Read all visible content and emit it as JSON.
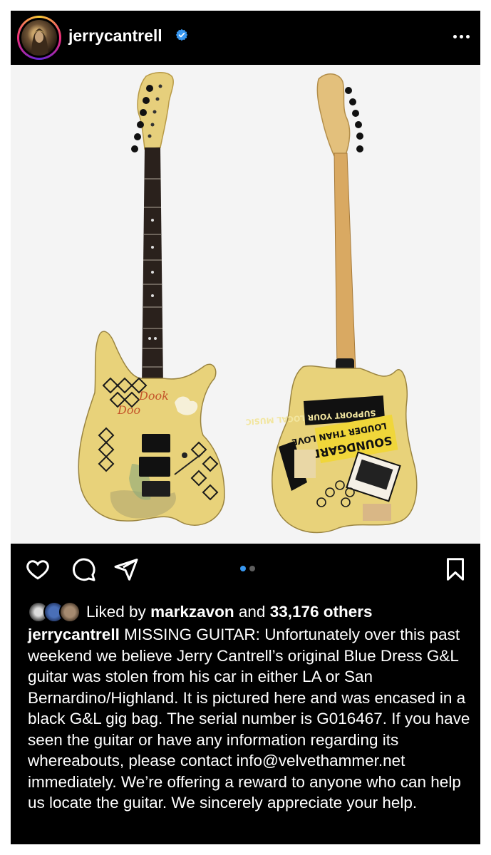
{
  "post": {
    "username": "jerrycantrell",
    "verified": true,
    "carousel": {
      "count": 2,
      "active_index": 0
    },
    "icons": [
      "verified-badge-icon",
      "more-options-icon",
      "heart-icon",
      "comment-icon",
      "share-icon",
      "bookmark-icon"
    ]
  },
  "likes": {
    "prefix": "Liked by",
    "user": "markzavon",
    "middle": "and",
    "count_text": "33,176 others"
  },
  "caption": {
    "username": "jerrycantrell",
    "text": "MISSING GUITAR: Unfortunately over this past weekend we believe Jerry Cantrell’s original Blue Dress G&L guitar was stolen from his car in either LA or San Bernardino/Highland. It is pictured here and was encased in a black G&L gig bag. The serial number is G016467. If you have seen the guitar or have any information regarding its whereabouts, please contact info@velvethammer.net immediately. We’re offering a reward to anyone who can help us locate the guitar. We sincerely appreciate your help."
  },
  "colors": {
    "background": "#000000",
    "text": "#ffffff",
    "verified": "#3897f0",
    "carousel_active": "#3897f0",
    "carousel_inactive": "#5e5e5e",
    "guitar_body": "#e8d27a"
  }
}
